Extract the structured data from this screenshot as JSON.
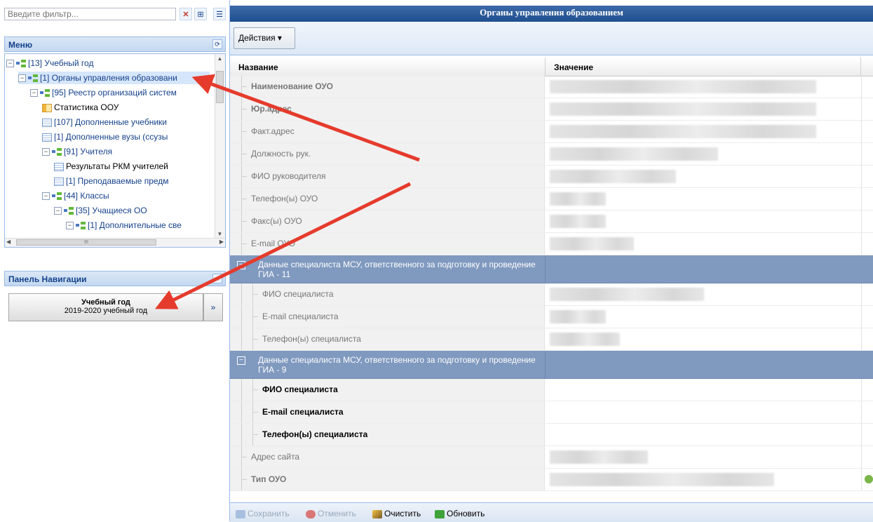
{
  "filter": {
    "placeholder": "Введите фильтр..."
  },
  "menu_panel": {
    "title": "Меню"
  },
  "tree": [
    {
      "label": "[13] Учебный год",
      "indent": 0,
      "icon": "org-icon",
      "toggle": "−",
      "selected": false,
      "dark": false
    },
    {
      "label": "[1] Органы управления образовани",
      "indent": 1,
      "icon": "org-icon",
      "toggle": "−",
      "selected": true,
      "dark": false
    },
    {
      "label": "[95] Реестр организаций систем",
      "indent": 2,
      "icon": "org-icon",
      "toggle": "−",
      "selected": false,
      "dark": false
    },
    {
      "label": "Статистика ООУ",
      "indent": 3,
      "icon": "stat-icon",
      "toggle": "",
      "selected": false,
      "dark": true
    },
    {
      "label": "[107] Дополненные учебники",
      "indent": 3,
      "icon": "grid-icon",
      "toggle": "",
      "selected": false,
      "dark": false
    },
    {
      "label": "[1] Дополненные вузы (ссузы",
      "indent": 3,
      "icon": "grid-icon",
      "toggle": "",
      "selected": false,
      "dark": false
    },
    {
      "label": "[91] Учителя",
      "indent": 3,
      "icon": "org-icon",
      "toggle": "−",
      "selected": false,
      "dark": false
    },
    {
      "label": "Результаты РКМ учителей",
      "indent": 4,
      "icon": "grid-icon",
      "toggle": "",
      "selected": false,
      "dark": true
    },
    {
      "label": "[1] Преподаваемые предм",
      "indent": 4,
      "icon": "grid-icon",
      "toggle": "",
      "selected": false,
      "dark": false
    },
    {
      "label": "[44] Классы",
      "indent": 3,
      "icon": "org-icon",
      "toggle": "−",
      "selected": false,
      "dark": false
    },
    {
      "label": "[35] Учащиеся ОО",
      "indent": 4,
      "icon": "org-icon",
      "toggle": "−",
      "selected": false,
      "dark": false
    },
    {
      "label": "[1] Дополнительные све",
      "indent": 5,
      "icon": "org-icon",
      "toggle": "−",
      "selected": false,
      "dark": false
    }
  ],
  "tree_hscroll_thumb": "III",
  "nav_panel": {
    "title": "Панель Навигации"
  },
  "nav_year": {
    "title": "Учебный год",
    "value": "2019-2020 учебный год",
    "more": "»"
  },
  "main": {
    "title": "Органы управления образованием",
    "actions_label": "Действия ▾",
    "col_name": "Название",
    "col_value": "Значение"
  },
  "rows": [
    {
      "type": "row",
      "label": "Наименование ОУО",
      "level": 1,
      "bold": true,
      "dark": false,
      "blur_width": 380
    },
    {
      "type": "row",
      "label": "Юр.адрес",
      "level": 1,
      "bold": true,
      "dark": false,
      "blur_width": 380
    },
    {
      "type": "row",
      "label": "Факт.адрес",
      "level": 1,
      "bold": false,
      "dark": false,
      "blur_width": 380
    },
    {
      "type": "row",
      "label": "Должность рук.",
      "level": 1,
      "bold": false,
      "dark": false,
      "blur_width": 240
    },
    {
      "type": "row",
      "label": "ФИО руководителя",
      "level": 1,
      "bold": false,
      "dark": false,
      "blur_width": 180
    },
    {
      "type": "row",
      "label": "Телефон(ы) ОУО",
      "level": 1,
      "bold": false,
      "dark": false,
      "blur_width": 80
    },
    {
      "type": "row",
      "label": "Факс(ы) ОУО",
      "level": 1,
      "bold": false,
      "dark": false,
      "blur_width": 80
    },
    {
      "type": "row",
      "label": "E-mail ОУО",
      "level": 1,
      "bold": false,
      "dark": false,
      "blur_width": 120
    },
    {
      "type": "group",
      "label": "Данные специалиста МСУ, ответственного за подготовку и проведение ГИА - 11",
      "toggle": "−"
    },
    {
      "type": "row",
      "label": "ФИО специалиста",
      "level": 2,
      "bold": false,
      "dark": false,
      "blur_width": 220
    },
    {
      "type": "row",
      "label": "E-mail специалиста",
      "level": 2,
      "bold": false,
      "dark": false,
      "blur_width": 80
    },
    {
      "type": "row",
      "label": "Телефон(ы) специалиста",
      "level": 2,
      "bold": false,
      "dark": false,
      "blur_width": 100
    },
    {
      "type": "group",
      "label": "Данные специалиста МСУ, ответственного за подготовку и проведение ГИА - 9",
      "toggle": "−"
    },
    {
      "type": "row",
      "label": "ФИО специалиста",
      "level": 2,
      "bold": true,
      "dark": true,
      "blur_width": 0
    },
    {
      "type": "row",
      "label": "E-mail специалиста",
      "level": 2,
      "bold": true,
      "dark": true,
      "blur_width": 0
    },
    {
      "type": "row",
      "label": "Телефон(ы) специалиста",
      "level": 2,
      "bold": true,
      "dark": true,
      "blur_width": 0
    },
    {
      "type": "row",
      "label": "Адрес сайта",
      "level": 1,
      "bold": false,
      "dark": false,
      "blur_width": 140
    },
    {
      "type": "row",
      "label": "Тип ОУО",
      "level": 1,
      "bold": true,
      "dark": false,
      "blur_width": 320,
      "edit": true
    }
  ],
  "bottom": {
    "save": "Сохранить",
    "cancel": "Отменить",
    "clear": "Очистить",
    "refresh": "Обновить"
  },
  "colors": {
    "title_bar": "#2a5a9a",
    "group_row": "#8099bf",
    "arrow": "#e53b2c",
    "tree_link": "#15418b"
  }
}
